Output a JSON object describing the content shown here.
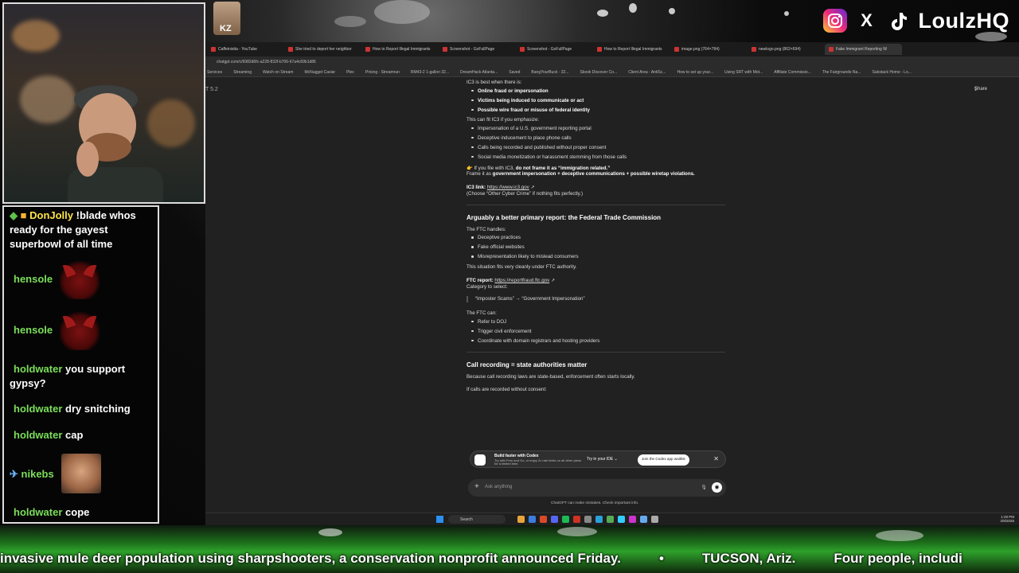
{
  "socials": {
    "instagram_icon": "instagram-icon",
    "x_icon": "X",
    "tiktok_icon": "tiktok-icon",
    "handle": "LoulzHQ"
  },
  "top_emote": {
    "label": "KZ"
  },
  "browser": {
    "tabs": [
      "Caffeinistta - YouTube",
      "She tried to deport her neighbor",
      "How to Report Illegal Immigrants",
      "Screenshot - GoFullPage",
      "Screenshot - GoFullPage",
      "How to Report Illegal Immigrants",
      "image.png (764×784)",
      "newlogo.png (862×694)",
      "Fake Immigrant Reporting W"
    ],
    "url": "chatgpt.com/c/6982d6fc-a228-832f-b706-67a4c69b1d86",
    "bookmarks": [
      "Services",
      "Streaming",
      "Watch on Stream",
      "McNugget Caviar",
      "Plex",
      "Pricing - Streamrun",
      "RM43-2 1-gallon 32...",
      "DreamHack Atlanta...",
      "Saved",
      "BangYourBuck - 32...",
      "Skook Discover Co...",
      "Client Area - AntiSc...",
      "How to set up your...",
      "Using SRT with Mot...",
      "Affiliate Commissio...",
      "The Fairgrounds Na...",
      "Substack Home - Lo..."
    ],
    "model_label": "T 5.2",
    "share_label": "Share"
  },
  "conversation": {
    "intro": "IC3 is best when there is:",
    "ic3_list": [
      "Online fraud or impersonation",
      "Victims being induced to communicate or act",
      "Possible wire fraud or misuse of federal identity"
    ],
    "emphasize_intro": "This can fit IC3 if you emphasize:",
    "emphasize_list": [
      "Impersonation of a U.S. government reporting portal",
      "Deceptive inducement to place phone calls",
      "Calls being recorded and published without proper consent",
      "Social media monetization or harassment stemming from those calls"
    ],
    "frame_note_prefix": "If you file with IC3, ",
    "frame_note_bold": "do not frame it as “immigration related.”",
    "frame_line_prefix": "Frame it as ",
    "frame_line_bold": "government impersonation + deceptive communications + possible wiretap violations.",
    "ic3_link_label": "IC3 link:",
    "ic3_link": "https://www.ic3.gov",
    "ic3_choose": "(Choose “Other Cyber Crime” if nothing fits perfectly.)",
    "ftc_heading": "Arguably a better primary report: the Federal Trade Commission",
    "ftc_handles": "The FTC handles:",
    "ftc_list": [
      "Deceptive practices",
      "Fake official websites",
      "Misrepresentation likely to mislead consumers"
    ],
    "ftc_fits": "This situation fits very cleanly under FTC authority.",
    "ftc_report_label": "FTC report:",
    "ftc_report_link": "https://reportfraud.ftc.gov",
    "category_label": "Category to select:",
    "category_quote": "“Imposter Scams” → “Government Impersonation”",
    "ftc_can": "The FTC can:",
    "ftc_can_list": [
      "Refer to DOJ",
      "Trigger civil enforcement",
      "Coordinate with domain registrars and hosting providers"
    ],
    "rec_heading": "Call recording = state authorities matter",
    "rec_text": "Because call recording laws are state-based, enforcement often starts locally.",
    "rec_consent": "If calls are recorded without consent:"
  },
  "codex_banner": {
    "title": "Build faster with Codex",
    "subtitle": "Try with Free and Go, or enjoy 2x rate limits on all other plans for a limited time.",
    "try_ide": "Try in your IDE",
    "waitlist": "Join the Codex app waitlist"
  },
  "composer": {
    "placeholder": "Ask anything",
    "disclaimer": "ChatGPT can make mistakes. Check important info."
  },
  "taskbar": {
    "search": "Search",
    "time": "1:29 PM",
    "date": "2/8/2026"
  },
  "stream_chat": [
    {
      "user": "DonJolly",
      "text": "!blade whos ready for the gayest superbowl of all time"
    },
    {
      "user": "hensole",
      "text": ""
    },
    {
      "user": "hensole",
      "text": ""
    },
    {
      "user": "holdwater",
      "text": "you support gypsy?"
    },
    {
      "user": "holdwater",
      "text": "dry snitching"
    },
    {
      "user": "holdwater",
      "text": "cap"
    },
    {
      "user": "nikebs",
      "text": ""
    },
    {
      "user": "holdwater",
      "text": "cope"
    }
  ],
  "ticker": {
    "items": [
      "invasive mule deer population using sharpshooters, a conservation nonprofit announced Friday.",
      "•",
      "TUCSON, Ariz.",
      "Four people, includi"
    ]
  }
}
